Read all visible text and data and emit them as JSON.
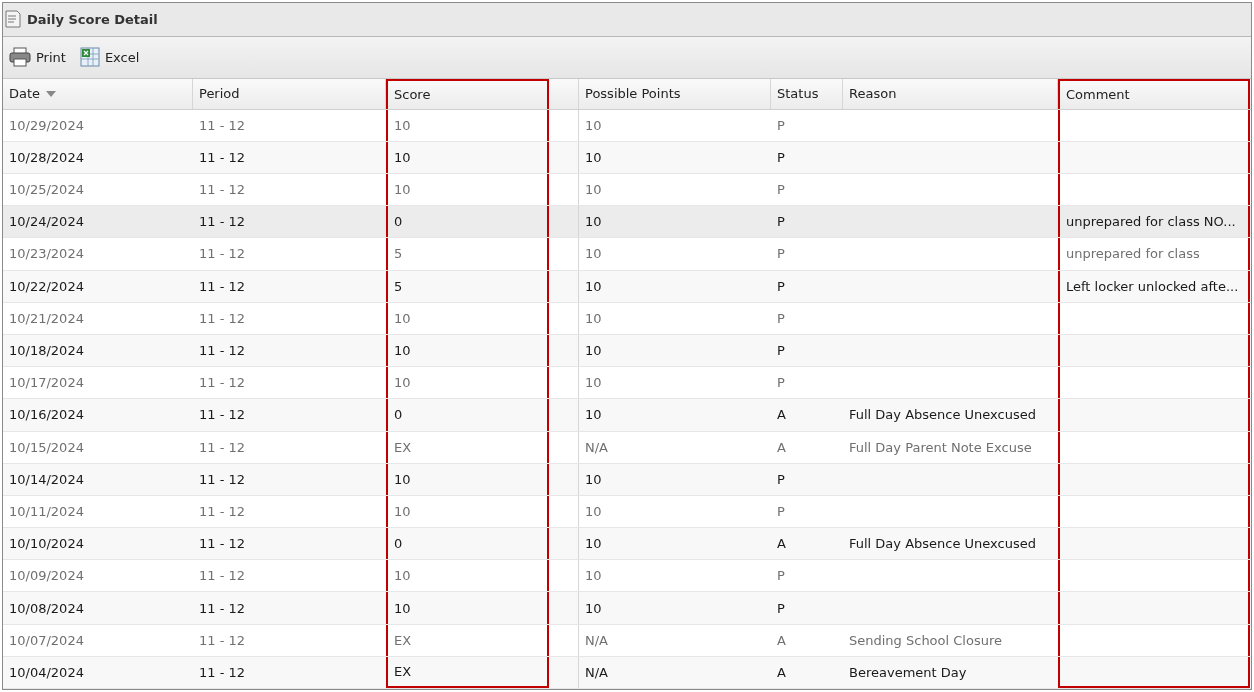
{
  "panel": {
    "title": "Daily Score Detail"
  },
  "toolbar": [
    {
      "kind": "print",
      "label": "Print"
    },
    {
      "kind": "excel",
      "label": "Excel"
    }
  ],
  "table": {
    "columns": [
      {
        "label": "Date",
        "sorted": true,
        "outlined": false
      },
      {
        "label": "Period",
        "sorted": false,
        "outlined": false
      },
      {
        "label": "Score",
        "sorted": false,
        "outlined": true
      },
      {
        "label": "Possible Points",
        "sorted": false,
        "outlined": false
      },
      {
        "label": "Status",
        "sorted": false,
        "outlined": false
      },
      {
        "label": "Reason",
        "sorted": false,
        "outlined": false
      },
      {
        "label": "Comment",
        "sorted": false,
        "outlined": true
      }
    ],
    "rows": [
      {
        "selected": false,
        "cells": [
          "10/29/2024",
          "11 - 12",
          "10",
          "10",
          "P",
          "",
          ""
        ]
      },
      {
        "selected": false,
        "cells": [
          "10/28/2024",
          "11 - 12",
          "10",
          "10",
          "P",
          "",
          ""
        ]
      },
      {
        "selected": false,
        "cells": [
          "10/25/2024",
          "11 - 12",
          "10",
          "10",
          "P",
          "",
          ""
        ]
      },
      {
        "selected": true,
        "cells": [
          "10/24/2024",
          "11 - 12",
          "0",
          "10",
          "P",
          "",
          "unprepared for class NO..."
        ]
      },
      {
        "selected": false,
        "cells": [
          "10/23/2024",
          "11 - 12",
          "5",
          "10",
          "P",
          "",
          "unprepared for class"
        ]
      },
      {
        "selected": false,
        "cells": [
          "10/22/2024",
          "11 - 12",
          "5",
          "10",
          "P",
          "",
          "Left locker unlocked afte..."
        ]
      },
      {
        "selected": false,
        "cells": [
          "10/21/2024",
          "11 - 12",
          "10",
          "10",
          "P",
          "",
          ""
        ]
      },
      {
        "selected": false,
        "cells": [
          "10/18/2024",
          "11 - 12",
          "10",
          "10",
          "P",
          "",
          ""
        ]
      },
      {
        "selected": false,
        "cells": [
          "10/17/2024",
          "11 - 12",
          "10",
          "10",
          "P",
          "",
          ""
        ]
      },
      {
        "selected": false,
        "cells": [
          "10/16/2024",
          "11 - 12",
          "0",
          "10",
          "A",
          "Full Day Absence Unexcused",
          ""
        ]
      },
      {
        "selected": false,
        "cells": [
          "10/15/2024",
          "11 - 12",
          "EX",
          "N/A",
          "A",
          "Full Day Parent Note Excuse",
          ""
        ]
      },
      {
        "selected": false,
        "cells": [
          "10/14/2024",
          "11 - 12",
          "10",
          "10",
          "P",
          "",
          ""
        ]
      },
      {
        "selected": false,
        "cells": [
          "10/11/2024",
          "11 - 12",
          "10",
          "10",
          "P",
          "",
          ""
        ]
      },
      {
        "selected": false,
        "cells": [
          "10/10/2024",
          "11 - 12",
          "0",
          "10",
          "A",
          "Full Day Absence Unexcused",
          ""
        ]
      },
      {
        "selected": false,
        "cells": [
          "10/09/2024",
          "11 - 12",
          "10",
          "10",
          "P",
          "",
          ""
        ]
      },
      {
        "selected": false,
        "cells": [
          "10/08/2024",
          "11 - 12",
          "10",
          "10",
          "P",
          "",
          ""
        ]
      },
      {
        "selected": false,
        "cells": [
          "10/07/2024",
          "11 - 12",
          "EX",
          "N/A",
          "A",
          "Sending School Closure",
          ""
        ]
      },
      {
        "selected": false,
        "cells": [
          "10/04/2024",
          "11 - 12",
          "EX",
          "N/A",
          "A",
          "Bereavement Day",
          ""
        ]
      }
    ]
  }
}
